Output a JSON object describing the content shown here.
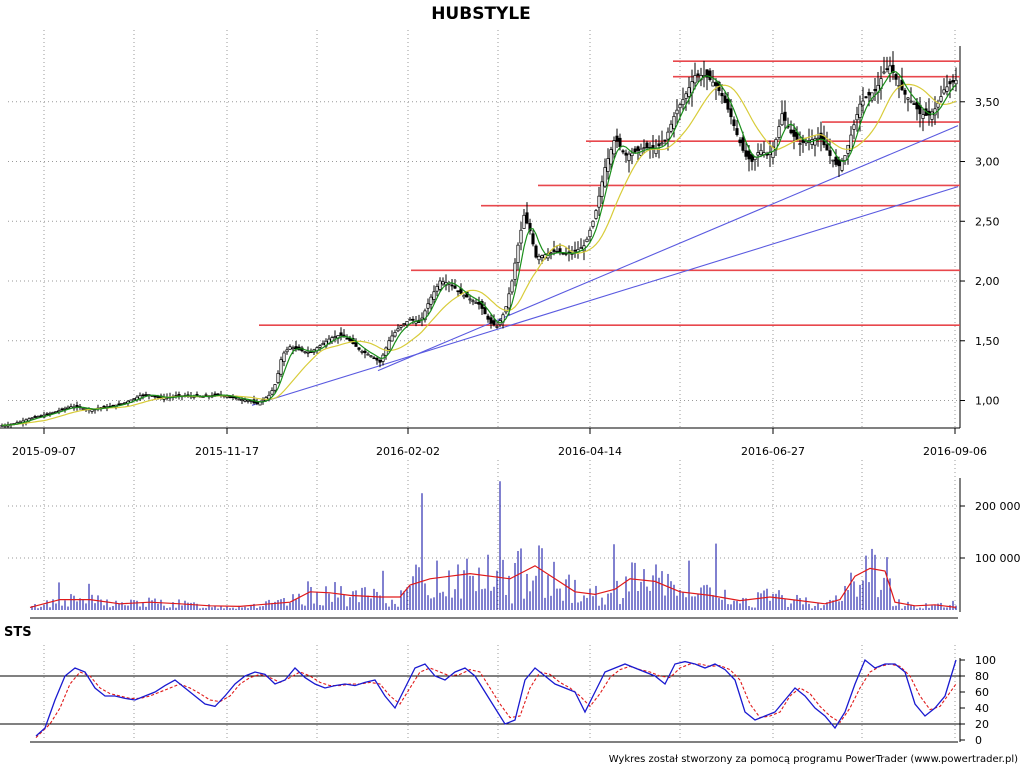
{
  "title": "HUBSTYLE",
  "footer": "Wykres został stworzony za pomocą programu PowerTrader (www.powertrader.pl)",
  "indicator_label": "STS",
  "colors": {
    "candle": "#000000",
    "ma_short": "#1a8f1a",
    "ma_long": "#d8cc3a",
    "support": "#e8474c",
    "trendline": "#5a5ae0",
    "volume": "#1a1aa8",
    "volume_ma": "#e01a1a",
    "sts_k": "#1a1ad0",
    "sts_d": "#e01a1a"
  },
  "chart_data": [
    {
      "type": "candlestick",
      "title": "HUBSTYLE",
      "x_ticks": [
        "2015-09-07",
        "2015-11-17",
        "2016-02-02",
        "2016-04-14",
        "2016-06-27",
        "2016-09-06"
      ],
      "y_ticks": [
        "1,00",
        "1,50",
        "2,00",
        "2,50",
        "3,00",
        "3,50"
      ],
      "ylim": [
        0.77,
        3.95
      ],
      "grid": true,
      "price_close": [
        [
          0,
          0.79
        ],
        [
          10,
          0.8
        ],
        [
          20,
          0.82
        ],
        [
          30,
          0.85
        ],
        [
          45,
          0.88
        ],
        [
          60,
          0.92
        ],
        [
          70,
          0.95
        ],
        [
          80,
          0.94
        ],
        [
          90,
          0.92
        ],
        [
          100,
          0.94
        ],
        [
          110,
          0.95
        ],
        [
          120,
          0.97
        ],
        [
          130,
          1.0
        ],
        [
          140,
          1.04
        ],
        [
          150,
          1.05
        ],
        [
          160,
          1.02
        ],
        [
          170,
          1.03
        ],
        [
          180,
          1.04
        ],
        [
          190,
          1.04
        ],
        [
          200,
          1.03
        ],
        [
          210,
          1.04
        ],
        [
          220,
          1.05
        ],
        [
          230,
          1.03
        ],
        [
          240,
          1.01
        ],
        [
          250,
          1.0
        ],
        [
          256,
          0.97
        ],
        [
          262,
          1.0
        ],
        [
          270,
          1.05
        ],
        [
          276,
          1.15
        ],
        [
          282,
          1.38
        ],
        [
          290,
          1.45
        ],
        [
          300,
          1.42
        ],
        [
          310,
          1.4
        ],
        [
          320,
          1.46
        ],
        [
          330,
          1.52
        ],
        [
          340,
          1.55
        ],
        [
          350,
          1.5
        ],
        [
          360,
          1.42
        ],
        [
          370,
          1.38
        ],
        [
          380,
          1.32
        ],
        [
          390,
          1.52
        ],
        [
          400,
          1.62
        ],
        [
          410,
          1.68
        ],
        [
          420,
          1.65
        ],
        [
          430,
          1.85
        ],
        [
          440,
          2.0
        ],
        [
          450,
          1.98
        ],
        [
          460,
          1.9
        ],
        [
          470,
          1.85
        ],
        [
          480,
          1.8
        ],
        [
          490,
          1.65
        ],
        [
          497,
          1.62
        ],
        [
          505,
          1.75
        ],
        [
          512,
          2.0
        ],
        [
          518,
          2.3
        ],
        [
          524,
          2.55
        ],
        [
          530,
          2.42
        ],
        [
          536,
          2.2
        ],
        [
          545,
          2.22
        ],
        [
          555,
          2.25
        ],
        [
          565,
          2.22
        ],
        [
          575,
          2.25
        ],
        [
          585,
          2.3
        ],
        [
          595,
          2.55
        ],
        [
          605,
          2.95
        ],
        [
          615,
          3.2
        ],
        [
          625,
          3.05
        ],
        [
          635,
          3.08
        ],
        [
          645,
          3.12
        ],
        [
          655,
          3.1
        ],
        [
          665,
          3.18
        ],
        [
          675,
          3.4
        ],
        [
          685,
          3.55
        ],
        [
          695,
          3.72
        ],
        [
          705,
          3.72
        ],
        [
          715,
          3.65
        ],
        [
          722,
          3.55
        ],
        [
          730,
          3.4
        ],
        [
          738,
          3.2
        ],
        [
          745,
          3.05
        ],
        [
          752,
          3.0
        ],
        [
          760,
          3.1
        ],
        [
          768,
          3.05
        ],
        [
          775,
          3.15
        ],
        [
          782,
          3.4
        ],
        [
          790,
          3.25
        ],
        [
          800,
          3.15
        ],
        [
          810,
          3.18
        ],
        [
          820,
          3.2
        ],
        [
          830,
          3.05
        ],
        [
          838,
          2.95
        ],
        [
          845,
          3.05
        ],
        [
          852,
          3.25
        ],
        [
          860,
          3.48
        ],
        [
          868,
          3.55
        ],
        [
          876,
          3.6
        ],
        [
          884,
          3.75
        ],
        [
          890,
          3.8
        ],
        [
          898,
          3.65
        ],
        [
          906,
          3.55
        ],
        [
          914,
          3.48
        ],
        [
          920,
          3.4
        ],
        [
          928,
          3.38
        ],
        [
          936,
          3.45
        ],
        [
          944,
          3.6
        ],
        [
          950,
          3.65
        ],
        [
          956,
          3.68
        ]
      ],
      "support_lines": [
        {
          "x_start": 673,
          "value": 3.84
        },
        {
          "x_start": 673,
          "value": 3.71
        },
        {
          "x_start": 822,
          "value": 3.33
        },
        {
          "x_start": 586,
          "value": 3.17
        },
        {
          "x_start": 538,
          "value": 2.8
        },
        {
          "x_start": 481,
          "value": 2.63
        },
        {
          "x_start": 411,
          "value": 2.09
        },
        {
          "x_start": 259,
          "value": 1.63
        }
      ],
      "trendlines": [
        {
          "from": [
            252,
            0.96
          ],
          "to": [
            958,
            2.79
          ]
        },
        {
          "from": [
            378,
            1.25
          ],
          "to": [
            958,
            3.3
          ]
        }
      ]
    },
    {
      "type": "bar",
      "series_name": "volume",
      "y_ticks": [
        "100 000",
        "200 000"
      ],
      "ylim": [
        0,
        250000
      ],
      "volume_ma": [
        [
          30,
          5000
        ],
        [
          60,
          20000
        ],
        [
          90,
          20000
        ],
        [
          120,
          12000
        ],
        [
          150,
          15000
        ],
        [
          180,
          12000
        ],
        [
          210,
          8000
        ],
        [
          240,
          7000
        ],
        [
          270,
          12000
        ],
        [
          290,
          15000
        ],
        [
          310,
          35000
        ],
        [
          330,
          33000
        ],
        [
          350,
          28000
        ],
        [
          380,
          25000
        ],
        [
          400,
          25000
        ],
        [
          410,
          48000
        ],
        [
          430,
          60000
        ],
        [
          450,
          65000
        ],
        [
          470,
          70000
        ],
        [
          490,
          65000
        ],
        [
          510,
          60000
        ],
        [
          525,
          75000
        ],
        [
          535,
          85000
        ],
        [
          555,
          60000
        ],
        [
          575,
          35000
        ],
        [
          595,
          30000
        ],
        [
          615,
          40000
        ],
        [
          630,
          60000
        ],
        [
          655,
          55000
        ],
        [
          680,
          35000
        ],
        [
          710,
          28000
        ],
        [
          740,
          18000
        ],
        [
          770,
          25000
        ],
        [
          800,
          18000
        ],
        [
          825,
          12000
        ],
        [
          840,
          20000
        ],
        [
          855,
          65000
        ],
        [
          870,
          80000
        ],
        [
          885,
          75000
        ],
        [
          895,
          15000
        ],
        [
          915,
          8000
        ],
        [
          935,
          10000
        ],
        [
          956,
          5000
        ]
      ]
    },
    {
      "type": "line",
      "series_name": "STS",
      "y_ticks": [
        "0",
        "20",
        "40",
        "60",
        "80",
        "100"
      ],
      "ylim": [
        0,
        100
      ],
      "reference_lines": [
        20,
        80
      ],
      "k": [
        [
          36,
          5
        ],
        [
          45,
          15
        ],
        [
          55,
          50
        ],
        [
          65,
          80
        ],
        [
          75,
          90
        ],
        [
          85,
          85
        ],
        [
          95,
          65
        ],
        [
          105,
          55
        ],
        [
          115,
          55
        ],
        [
          125,
          52
        ],
        [
          135,
          50
        ],
        [
          145,
          55
        ],
        [
          155,
          60
        ],
        [
          165,
          68
        ],
        [
          175,
          75
        ],
        [
          185,
          65
        ],
        [
          195,
          55
        ],
        [
          205,
          45
        ],
        [
          215,
          42
        ],
        [
          225,
          55
        ],
        [
          235,
          70
        ],
        [
          245,
          80
        ],
        [
          255,
          85
        ],
        [
          265,
          82
        ],
        [
          275,
          70
        ],
        [
          285,
          75
        ],
        [
          295,
          90
        ],
        [
          305,
          78
        ],
        [
          315,
          70
        ],
        [
          325,
          65
        ],
        [
          335,
          68
        ],
        [
          345,
          70
        ],
        [
          355,
          68
        ],
        [
          365,
          72
        ],
        [
          375,
          75
        ],
        [
          385,
          55
        ],
        [
          395,
          40
        ],
        [
          405,
          65
        ],
        [
          415,
          90
        ],
        [
          425,
          95
        ],
        [
          435,
          80
        ],
        [
          445,
          75
        ],
        [
          455,
          85
        ],
        [
          465,
          90
        ],
        [
          475,
          80
        ],
        [
          485,
          60
        ],
        [
          495,
          40
        ],
        [
          505,
          20
        ],
        [
          515,
          25
        ],
        [
          525,
          75
        ],
        [
          535,
          90
        ],
        [
          545,
          80
        ],
        [
          555,
          70
        ],
        [
          565,
          65
        ],
        [
          575,
          60
        ],
        [
          585,
          35
        ],
        [
          595,
          60
        ],
        [
          605,
          85
        ],
        [
          615,
          90
        ],
        [
          625,
          95
        ],
        [
          635,
          90
        ],
        [
          645,
          85
        ],
        [
          655,
          80
        ],
        [
          665,
          70
        ],
        [
          675,
          95
        ],
        [
          685,
          98
        ],
        [
          695,
          95
        ],
        [
          705,
          90
        ],
        [
          715,
          95
        ],
        [
          725,
          88
        ],
        [
          735,
          75
        ],
        [
          745,
          35
        ],
        [
          755,
          25
        ],
        [
          765,
          30
        ],
        [
          775,
          35
        ],
        [
          785,
          50
        ],
        [
          795,
          65
        ],
        [
          805,
          55
        ],
        [
          815,
          40
        ],
        [
          825,
          30
        ],
        [
          835,
          15
        ],
        [
          845,
          35
        ],
        [
          855,
          70
        ],
        [
          865,
          100
        ],
        [
          875,
          90
        ],
        [
          885,
          95
        ],
        [
          895,
          95
        ],
        [
          905,
          85
        ],
        [
          915,
          45
        ],
        [
          925,
          30
        ],
        [
          935,
          40
        ],
        [
          945,
          55
        ],
        [
          956,
          100
        ]
      ],
      "d": [
        [
          36,
          3
        ],
        [
          50,
          20
        ],
        [
          60,
          40
        ],
        [
          70,
          70
        ],
        [
          80,
          85
        ],
        [
          90,
          80
        ],
        [
          100,
          65
        ],
        [
          110,
          58
        ],
        [
          120,
          55
        ],
        [
          130,
          52
        ],
        [
          140,
          52
        ],
        [
          150,
          55
        ],
        [
          160,
          60
        ],
        [
          170,
          65
        ],
        [
          180,
          70
        ],
        [
          190,
          65
        ],
        [
          200,
          58
        ],
        [
          210,
          50
        ],
        [
          220,
          48
        ],
        [
          230,
          55
        ],
        [
          240,
          70
        ],
        [
          250,
          78
        ],
        [
          260,
          82
        ],
        [
          270,
          78
        ],
        [
          280,
          72
        ],
        [
          290,
          78
        ],
        [
          300,
          85
        ],
        [
          310,
          80
        ],
        [
          320,
          72
        ],
        [
          330,
          68
        ],
        [
          340,
          68
        ],
        [
          350,
          70
        ],
        [
          360,
          70
        ],
        [
          370,
          72
        ],
        [
          380,
          70
        ],
        [
          390,
          55
        ],
        [
          400,
          45
        ],
        [
          410,
          65
        ],
        [
          420,
          85
        ],
        [
          430,
          90
        ],
        [
          440,
          85
        ],
        [
          450,
          80
        ],
        [
          460,
          82
        ],
        [
          470,
          88
        ],
        [
          480,
          85
        ],
        [
          490,
          65
        ],
        [
          500,
          45
        ],
        [
          510,
          28
        ],
        [
          520,
          30
        ],
        [
          530,
          65
        ],
        [
          540,
          85
        ],
        [
          550,
          82
        ],
        [
          560,
          72
        ],
        [
          570,
          65
        ],
        [
          580,
          55
        ],
        [
          590,
          42
        ],
        [
          600,
          58
        ],
        [
          610,
          78
        ],
        [
          620,
          88
        ],
        [
          630,
          92
        ],
        [
          640,
          88
        ],
        [
          650,
          85
        ],
        [
          660,
          80
        ],
        [
          670,
          78
        ],
        [
          680,
          90
        ],
        [
          690,
          95
        ],
        [
          700,
          95
        ],
        [
          710,
          92
        ],
        [
          720,
          93
        ],
        [
          730,
          88
        ],
        [
          740,
          75
        ],
        [
          750,
          45
        ],
        [
          760,
          28
        ],
        [
          770,
          30
        ],
        [
          780,
          35
        ],
        [
          790,
          55
        ],
        [
          800,
          65
        ],
        [
          810,
          58
        ],
        [
          820,
          42
        ],
        [
          830,
          30
        ],
        [
          840,
          22
        ],
        [
          850,
          40
        ],
        [
          860,
          65
        ],
        [
          870,
          85
        ],
        [
          880,
          92
        ],
        [
          890,
          95
        ],
        [
          900,
          92
        ],
        [
          910,
          80
        ],
        [
          920,
          55
        ],
        [
          930,
          38
        ],
        [
          940,
          42
        ],
        [
          956,
          70
        ]
      ]
    }
  ]
}
